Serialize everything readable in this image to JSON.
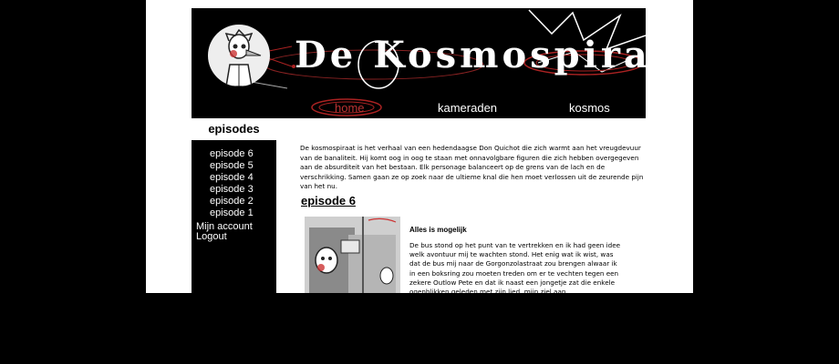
{
  "site": {
    "logo_text": "De Kosmospiraat"
  },
  "nav": {
    "items": [
      {
        "label": "home",
        "active": true
      },
      {
        "label": "kameraden",
        "active": false
      },
      {
        "label": "kosmos",
        "active": false
      }
    ]
  },
  "sidebar": {
    "tab_label": "episodes",
    "episodes": [
      "episode 6",
      "episode 5",
      "episode 4",
      "episode 3",
      "episode 2",
      "episode 1"
    ],
    "account_label": "Mijn account",
    "logout_label": "Logout"
  },
  "content": {
    "intro": "De kosmospiraat is het verhaal van een hedendaagse Don Quichot die zich warmt aan het vreugdevuur van de banaliteit. Hij komt oog in oog te staan met onnavolgbare figuren die zich hebben overgegeven aan de absurditeit van het bestaan. Elk personage balanceert op de grens van de lach en de verschrikking. Samen gaan ze op zoek naar de ultieme knal die hen moet verlossen uit de zeurende pijn van het nu.",
    "episode_title": "episode 6",
    "story_title": "Alles is mogelijk",
    "story_text": "De bus stond op het punt van te vertrekken en ik had geen idee welk avontuur mij te wachten stond. Het enig wat ik wist, was dat de bus mij naar de Gorgonzolastraat zou brengen alwaar ik in een boksring zou moeten treden om er te vechten tegen een zekere Outlow Pete en dat ik naast een jongetje zat die enkele ogenblikken geleden met zijn lied, mijn ziel aan"
  },
  "colors": {
    "background": "#000000",
    "page": "#ffffff",
    "accent_red": "#b33333"
  }
}
